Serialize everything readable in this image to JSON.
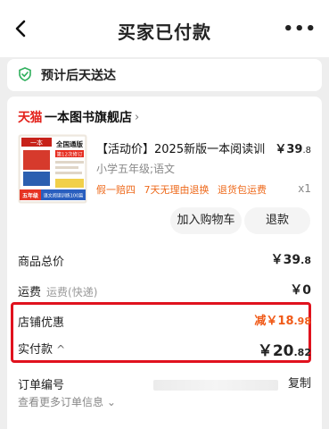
{
  "header": {
    "title": "买家已付款",
    "more": "•••"
  },
  "delivery": {
    "text": "预计后天送达"
  },
  "store": {
    "brand": "天猫",
    "name": "一本图书旗舰店",
    "chevron": "›"
  },
  "product": {
    "title": "【活动价】2025新版一本阅读训",
    "price_main": "￥39",
    "price_decimal": ".8",
    "spec": "小学五年级;语文",
    "tags": [
      "假一赔四",
      "7天无理由退换",
      "退货包运费"
    ],
    "qty": "x1",
    "cover": {
      "top_label": "一本",
      "headline_1": "全国通版",
      "headline_2": "第12次修订",
      "grade": "五年级",
      "footer": "语文阅读训练100篇"
    }
  },
  "buttons": {
    "add_cart": "加入购物车",
    "refund": "退款"
  },
  "summary": {
    "goods_total_label": "商品总价",
    "goods_total_main": "￥39",
    "goods_total_decimal": ".8",
    "shipping_label": "运费",
    "shipping_sub": "运费(快递)",
    "shipping_value": "￥0",
    "discount_label": "店铺优惠",
    "discount_main": "减￥18",
    "discount_decimal": ".98",
    "paid_label": "实付款",
    "paid_chevron": "^",
    "paid_main": "￥20",
    "paid_decimal": ".82"
  },
  "order_info": {
    "number_label": "订单编号",
    "copy": "复制",
    "more_info": "查看更多订单信息 ⌄"
  },
  "colors": {
    "brand_red": "#e3211b",
    "accent_orange": "#f05a18",
    "highlight_border": "#e0121e"
  }
}
